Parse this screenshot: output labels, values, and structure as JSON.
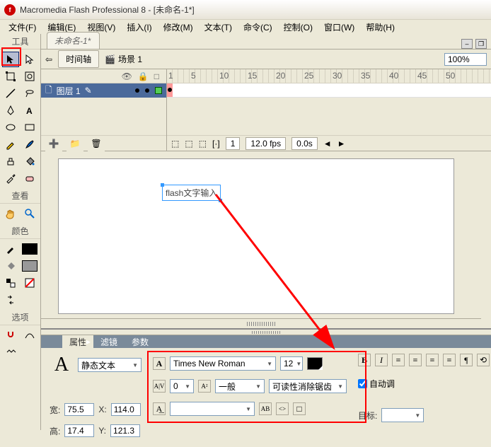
{
  "app": {
    "title": "Macromedia Flash Professional 8 - [未命名-1*]",
    "icon_letter": "f"
  },
  "menu": {
    "file": "文件(F)",
    "edit": "编辑(E)",
    "view": "视图(V)",
    "insert": "插入(I)",
    "modify": "修改(M)",
    "text": "文本(T)",
    "commands": "命令(C)",
    "control": "控制(O)",
    "window": "窗口(W)",
    "help": "帮助(H)"
  },
  "panels": {
    "tools": "工具",
    "view": "查看",
    "colors": "颜色",
    "options": "选项"
  },
  "doc": {
    "tab": "未命名-1*",
    "timeline_btn": "时间轴",
    "scene": "场景 1",
    "zoom": "100%"
  },
  "timeline": {
    "layer1": "图层 1",
    "ruler": [
      "1",
      "5",
      "10",
      "15",
      "20",
      "25",
      "30",
      "35",
      "40",
      "45",
      "50"
    ],
    "frame": "1",
    "fps": "12.0 fps",
    "elapsed": "0.0s"
  },
  "stage": {
    "text_content": "flash文字输入"
  },
  "props": {
    "tabs": {
      "properties": "属性",
      "filters": "滤镜",
      "params": "参数"
    },
    "text_type": "静态文本",
    "font": "Times New Roman",
    "size": "12",
    "kerning": "0",
    "spacing_mode": "一般",
    "antialias": "可读性消除锯齿",
    "w_lbl": "宽:",
    "w": "75.5",
    "x_lbl": "X:",
    "x": "114.0",
    "h_lbl": "高:",
    "h": "17.4",
    "y_lbl": "Y:",
    "y": "121.3",
    "bold": "B",
    "italic": "I",
    "autokern": "自动调",
    "target_lbl": "目标:"
  }
}
